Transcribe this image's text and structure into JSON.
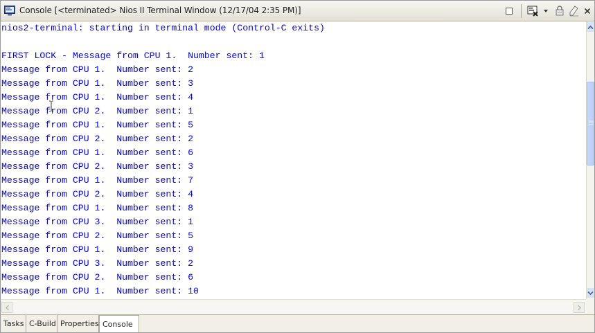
{
  "window": {
    "title": "Console [<terminated> Nios II Terminal Window (12/17/04 2:35 PM)]"
  },
  "toolbar": {
    "icons": [
      "maximize-icon",
      "display-selected-console-icon",
      "pin-console-icon",
      "clear-console-icon",
      "close-icon"
    ]
  },
  "console": {
    "lines": [
      "nios2-terminal: starting in terminal mode (Control-C exits)",
      "",
      "FIRST LOCK - Message from CPU 1.  Number sent: 1",
      "Message from CPU 1.  Number sent: 2",
      "Message from CPU 1.  Number sent: 3",
      "Message from CPU 1.  Number sent: 4",
      "Message from CPU 2.  Number sent: 1",
      "Message from CPU 1.  Number sent: 5",
      "Message from CPU 2.  Number sent: 2",
      "Message from CPU 1.  Number sent: 6",
      "Message from CPU 2.  Number sent: 3",
      "Message from CPU 1.  Number sent: 7",
      "Message from CPU 2.  Number sent: 4",
      "Message from CPU 1.  Number sent: 8",
      "Message from CPU 3.  Number sent: 1",
      "Message from CPU 2.  Number sent: 5",
      "Message from CPU 1.  Number sent: 9",
      "Message from CPU 3.  Number sent: 2",
      "Message from CPU 2.  Number sent: 6",
      "Message from CPU 1.  Number sent: 10"
    ],
    "text_color": "#0000ff"
  },
  "tabs": [
    {
      "label": "Tasks"
    },
    {
      "label": "C-Build"
    },
    {
      "label": "Properties"
    },
    {
      "label": "Console"
    }
  ],
  "active_tab": "Console"
}
